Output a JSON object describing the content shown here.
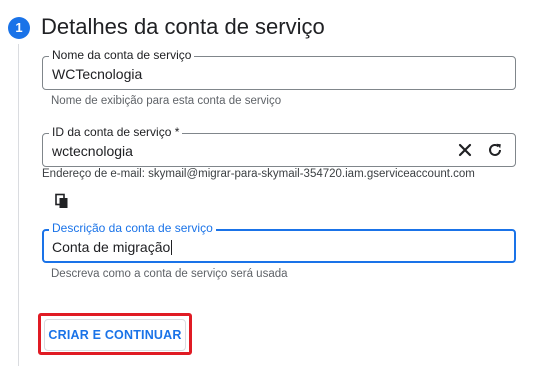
{
  "step": {
    "number": "1",
    "title": "Detalhes da conta de serviço"
  },
  "account_name": {
    "label": "Nome da conta de serviço",
    "value": "WCTecnologia",
    "hint": "Nome de exibição para esta conta de serviço"
  },
  "account_id": {
    "label": "ID da conta de serviço *",
    "value": "wctecnologia",
    "email_line": "Endereço de e-mail: skymail@migrar-para-skymail-354720.iam.gserviceaccount.com",
    "actions": [
      "clear-icon",
      "refresh-icon"
    ],
    "copy_icon": "copy-icon"
  },
  "description": {
    "label": "Descrição da conta de serviço",
    "value": "Conta de migração",
    "hint": "Descreva como a conta de serviço será usada"
  },
  "actions": {
    "submit_label": "CRIAR E CONTINUAR"
  },
  "colors": {
    "accent": "#1a73e8",
    "highlight": "#e01b24",
    "hint": "#5f6368"
  }
}
